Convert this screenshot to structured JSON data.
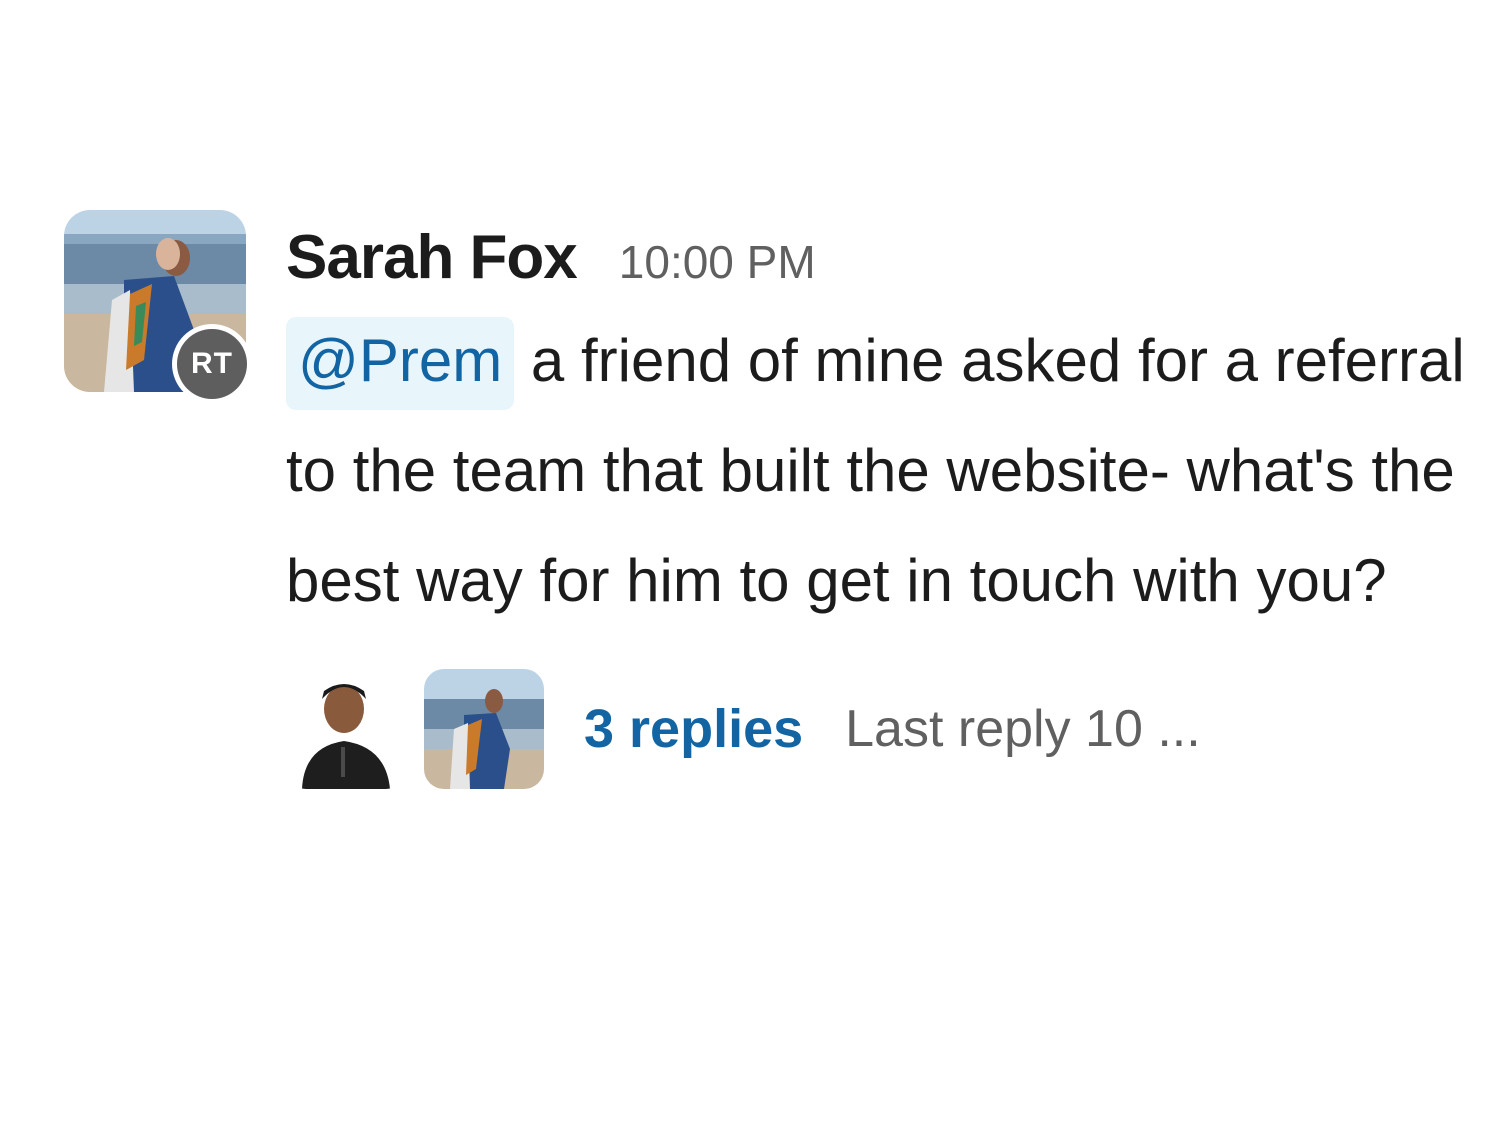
{
  "message": {
    "author": "Sarah Fox",
    "timestamp": "10:00 PM",
    "badge": "RT",
    "mention": "@Prem",
    "text": " a friend of mine asked for a referral to the team that built the website- what's the best way for him to get in touch with you?",
    "avatar_icon": "beach-photo",
    "thread": {
      "replies": "3 replies",
      "last_reply": "Last reply 10 ..."
    }
  },
  "colors": {
    "link": "#1264a3",
    "mention_bg": "#e8f5fa",
    "muted": "#616061",
    "badge": "#5e5e5e"
  }
}
